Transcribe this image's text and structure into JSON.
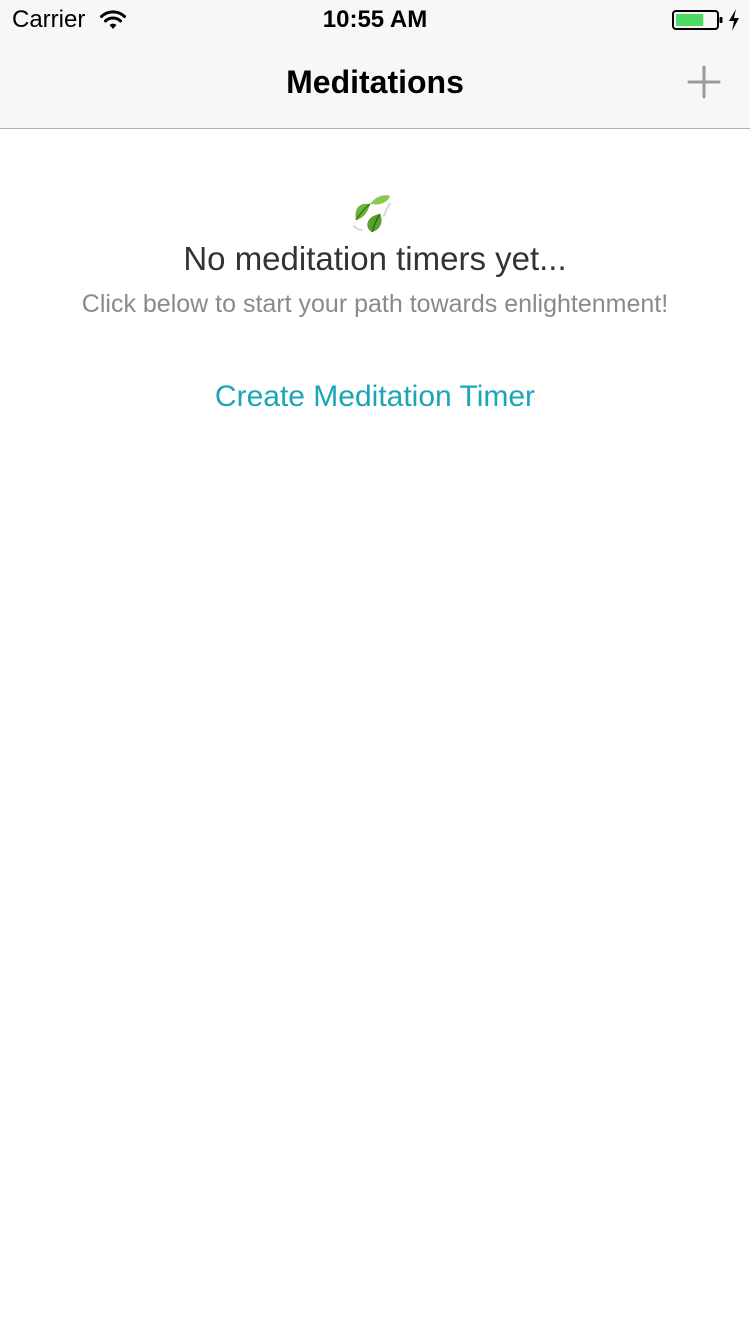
{
  "status_bar": {
    "carrier": "Carrier",
    "time": "10:55 AM",
    "battery_level": 0.7,
    "icons": [
      "wifi-icon",
      "battery-icon",
      "charging-icon"
    ]
  },
  "nav_bar": {
    "title": "Meditations",
    "add_icon": "plus-icon"
  },
  "empty_state": {
    "icon": "leaf-icon",
    "title": "No meditation timers yet...",
    "subtitle": "Click below to start your path towards enlightenment!",
    "action_label": "Create Meditation Timer"
  },
  "colors": {
    "accent": "#1aa6b7",
    "bar_background": "#f7f7f7",
    "battery_fill": "#4cd964",
    "title_text": "#333333",
    "subtitle_text": "#8a8a8a"
  }
}
